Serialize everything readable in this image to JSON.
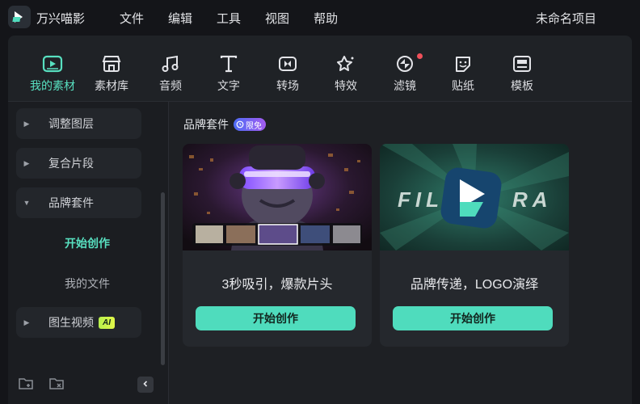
{
  "app": {
    "name": "万兴喵影",
    "project": "未命名项目"
  },
  "menu": [
    "文件",
    "编辑",
    "工具",
    "视图",
    "帮助"
  ],
  "toolbar": [
    {
      "label": "我的素材",
      "icon": "media-icon",
      "active": true
    },
    {
      "label": "素材库",
      "icon": "store-icon"
    },
    {
      "label": "音频",
      "icon": "music-icon"
    },
    {
      "label": "文字",
      "icon": "text-icon"
    },
    {
      "label": "转场",
      "icon": "transition-icon"
    },
    {
      "label": "特效",
      "icon": "effects-icon"
    },
    {
      "label": "滤镜",
      "icon": "filter-icon",
      "notification": true
    },
    {
      "label": "贴纸",
      "icon": "sticker-icon"
    },
    {
      "label": "模板",
      "icon": "template-icon"
    }
  ],
  "sidebar": {
    "items": [
      {
        "label": "调整图层",
        "expanded": false
      },
      {
        "label": "复合片段",
        "expanded": false
      },
      {
        "label": "品牌套件",
        "expanded": true
      },
      {
        "label": "图生视频",
        "expanded": false,
        "badge": "AI"
      }
    ],
    "subitems": [
      {
        "label": "开始创作",
        "active": true
      },
      {
        "label": "我的文件",
        "active": false
      }
    ]
  },
  "content": {
    "section_title": "品牌套件",
    "badge": "限免",
    "cards": [
      {
        "title": "3秒吸引，爆款片头",
        "button": "开始创作"
      },
      {
        "title": "品牌传递，LOGO演绎",
        "button": "开始创作",
        "thumb_text_left": "FIL",
        "thumb_text_right": "RA"
      }
    ]
  },
  "colors": {
    "accent": "#4fdcbd",
    "badge_start": "#4d6cf5",
    "badge_end": "#a45cf0"
  }
}
